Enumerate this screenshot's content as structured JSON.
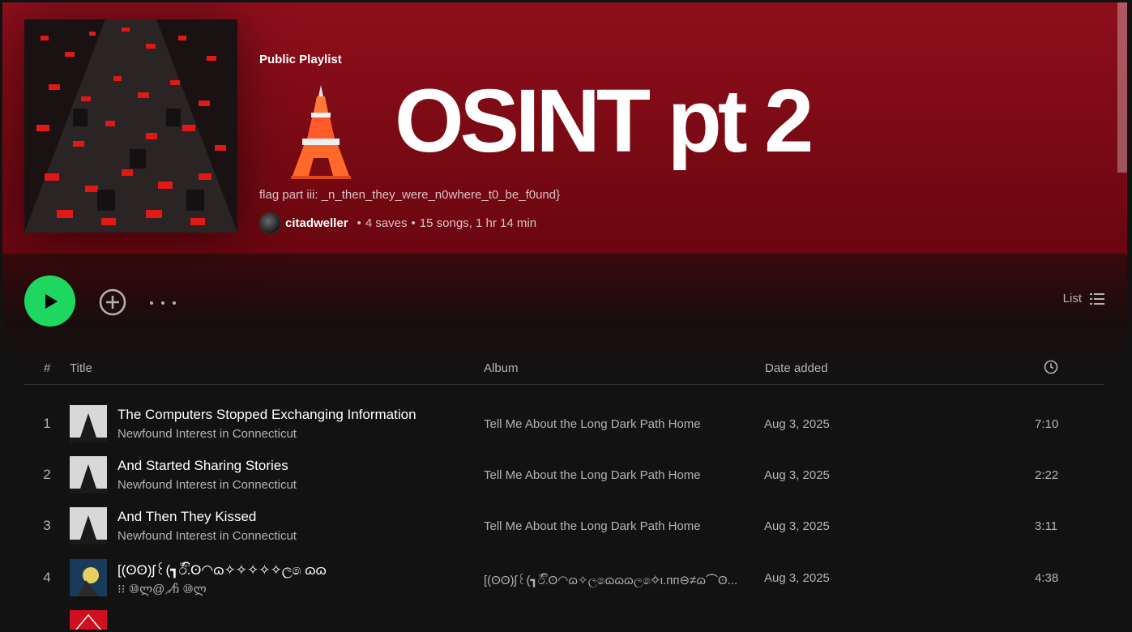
{
  "playlist": {
    "type_label": "Public Playlist",
    "title": "OSINT pt 2",
    "emoji_icon": "tokyo-tower-emoji",
    "description": "flag part iii: _n_then_they_were_n0where_t0_be_f0und}",
    "owner": "citadweller",
    "saves": "4 saves",
    "stats": "15 songs, 1 hr 14 min"
  },
  "controls": {
    "view_label": "List"
  },
  "columns": {
    "num": "#",
    "title": "Title",
    "album": "Album",
    "date_added": "Date added",
    "duration_icon": "clock-icon"
  },
  "tracks": [
    {
      "num": "1",
      "title": "The Computers Stopped Exchanging Information",
      "artist": "Newfound Interest in Connecticut",
      "album": "Tell Me About the Long Dark Path Home",
      "date": "Aug 3, 2025",
      "duration": "7:10"
    },
    {
      "num": "2",
      "title": "And Started Sharing Stories",
      "artist": "Newfound Interest in Connecticut",
      "album": "Tell Me About the Long Dark Path Home",
      "date": "Aug 3, 2025",
      "duration": "2:22"
    },
    {
      "num": "3",
      "title": "And Then They Kissed",
      "artist": "Newfound Interest in Connecticut",
      "album": "Tell Me About the Long Dark Path Home",
      "date": "Aug 3, 2025",
      "duration": "3:11"
    },
    {
      "num": "4",
      "title": "[(ʘʘ)ʃ꒰(┓ඊ.ිʘ◠ɷ✧✧✧✧✧ල෧ ɷɷ",
      "artist": "⁝⁝ ⑩ლ@⸝⁄ჩ ⑩ლ",
      "album": "[(ʘʘ)ʃ꒰(┓ඊ.ිʘ◠ɷ✧ල෧ɷɷɷල෧✧ι.ᴨᴨ⊖≠ɷ⌒ʘ...",
      "date": "Aug 3, 2025",
      "duration": "4:38"
    },
    {
      "num": "5",
      "title": "",
      "artist": "",
      "album": "",
      "date": "",
      "duration": ""
    }
  ],
  "colors": {
    "header_red": "#8e0f1c",
    "accent_green": "#1ed760",
    "background": "#121212"
  }
}
